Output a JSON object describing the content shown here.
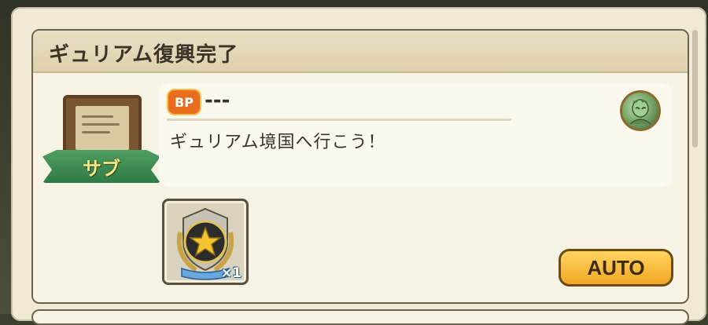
{
  "quest": {
    "title": "ギュリアム復興完了",
    "category_label": "サブ",
    "bp_icon_label": "BP",
    "bp_value": "---",
    "description": "ギュリアム境国へ行こう！",
    "reward": {
      "icon": "star-medal-icon",
      "quantity": "×1"
    },
    "auto_button_label": "AUTO"
  },
  "colors": {
    "panel_bg": "#efe9d6",
    "header_bg": "#ddd0ad",
    "banner_green": "#2f7a44",
    "auto_gold": "#f2a725",
    "bp_orange": "#e86d1f"
  }
}
